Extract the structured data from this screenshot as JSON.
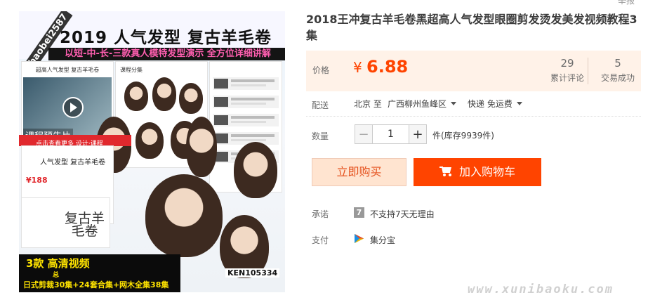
{
  "top_link": "举报",
  "product_image": {
    "title": "2019 人气发型 复古羊毛卷",
    "subtitle": "以短-中-长-三款真人模特发型演示 全方位详细讲解",
    "watermark": "baobei2587",
    "panel_a_heading": "超高人气发型 复古羊毛卷",
    "video_caption": "课程预告片",
    "panel_b_heading": "课程分集",
    "red_ribbon": "点击查看更多 设计·课程",
    "panel_d_title": "人气发型 复古羊毛卷",
    "panel_d_price": "¥188",
    "panel_e_title": "复古羊毛卷",
    "bottom_line1": "3款 高清视频",
    "bottom_line2": "总",
    "bottom_line3": "日式剪裁30集+24套合集+网木全集38集",
    "ken_id": "KEN105334"
  },
  "title": "2018王冲复古羊毛卷黑超高人气发型眼圈剪发烫发美发视频教程3集",
  "price": {
    "label": "价格",
    "currency": "¥",
    "value": "6.88",
    "reviews_count": "29",
    "reviews_label": "累计评论",
    "sales_count": "5",
    "sales_label": "交易成功"
  },
  "shipping": {
    "label": "配送",
    "from": "北京 至",
    "to": "广西柳州鱼峰区",
    "method": "快递 免运费"
  },
  "quantity": {
    "label": "数量",
    "minus": "−",
    "value": "1",
    "plus": "+",
    "stock": "件(库存9939件)"
  },
  "buttons": {
    "buy_now": "立即购买",
    "add_to_cart": "加入购物车"
  },
  "promise": {
    "label": "承诺",
    "icon_text": "7",
    "text": "不支持7天无理由"
  },
  "payment": {
    "label": "支付",
    "text": "集分宝"
  },
  "site_watermark": "www.xunibaoku.com",
  "colors": {
    "accent": "#ff4400",
    "price_bg": "#fff2e8",
    "buy_button_bg": "#ffe4d0"
  }
}
